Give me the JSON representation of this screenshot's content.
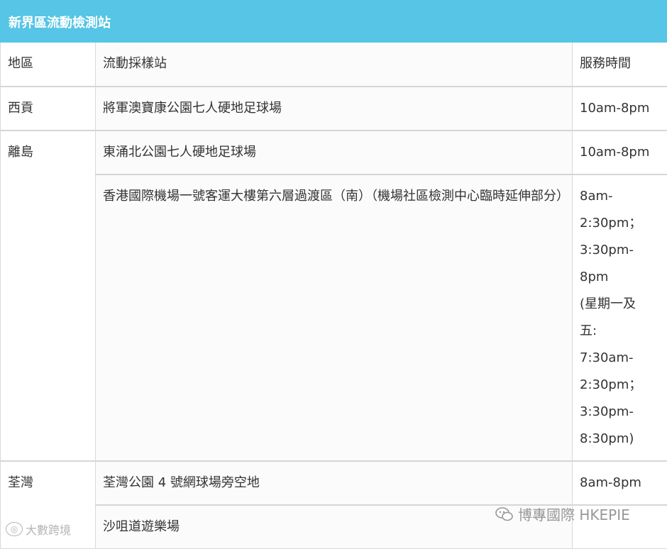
{
  "title": "新界區流動檢測站",
  "table": {
    "headers": {
      "region": "地區",
      "site": "流動採樣站",
      "hours": "服務時間"
    },
    "rows": [
      {
        "region": "西貢",
        "site": "將軍澳寶康公園七人硬地足球場",
        "hours": "10am-8pm"
      },
      {
        "region": "離島",
        "site": "東涌北公園七人硬地足球場",
        "hours": "10am-8pm"
      },
      {
        "region": "",
        "site": "香港國際機場一號客運大樓第六層過渡區（南）（機場社區檢測中心臨時延伸部分）",
        "hours": "8am-\n2:30pm；\n3:30pm-\n8pm\n(星期一及\n五:\n7:30am-\n2:30pm；\n3:30pm-\n8:30pm)"
      },
      {
        "region": "荃灣",
        "site": "荃灣公園 4 號網球場旁空地",
        "hours": "8am-8pm"
      },
      {
        "region": "",
        "site": "沙咀道遊樂場",
        "hours": ""
      }
    ]
  },
  "watermarks": {
    "left": "大數跨境",
    "right": "博專國際 HKEPIE"
  }
}
